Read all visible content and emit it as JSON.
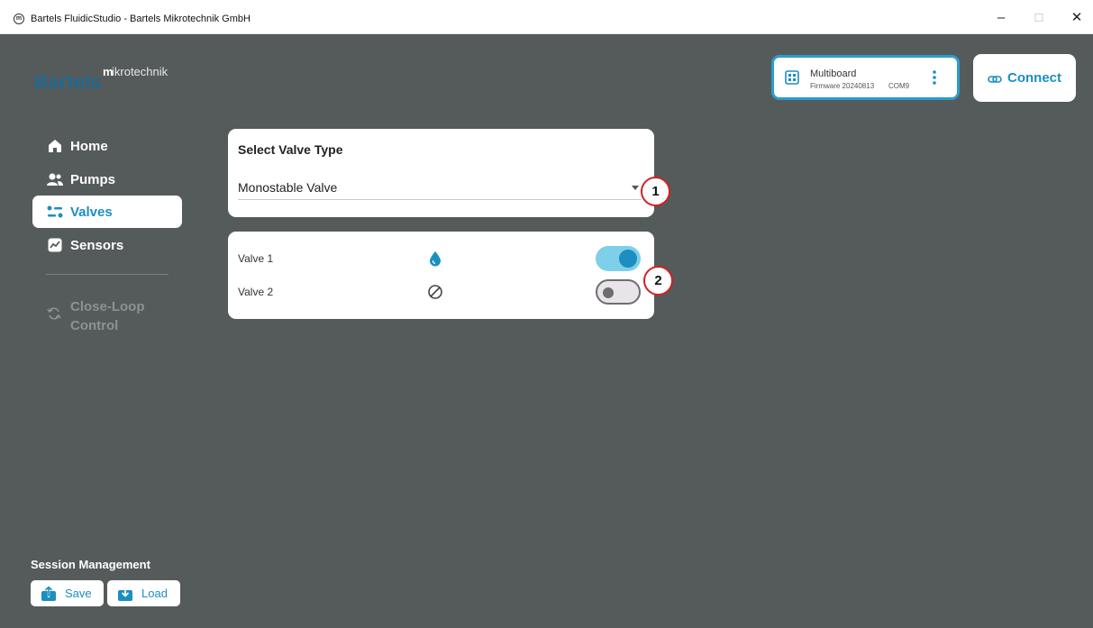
{
  "window": {
    "title": "Bartels FluidicStudio - Bartels Mikrotechnik GmbH",
    "app_icon": "m",
    "minimize_glyph": "–",
    "maximize_glyph": "☐",
    "close_glyph": "✕"
  },
  "logo": {
    "brand": "Bartels",
    "m": "m",
    "sub": "ikrotechnik"
  },
  "sidebar": {
    "items": [
      {
        "label": "Home",
        "icon": "home-icon",
        "active": false
      },
      {
        "label": "Pumps",
        "icon": "pumps-icon",
        "active": false
      },
      {
        "label": "Valves",
        "icon": "valves-icon",
        "active": true
      },
      {
        "label": "Sensors",
        "icon": "sensors-icon",
        "active": false
      }
    ],
    "close_loop": {
      "label": "Close-Loop Control",
      "icon": "refresh-icon",
      "disabled": true
    }
  },
  "session": {
    "title": "Session Management",
    "save_label": "Save",
    "load_label": "Load"
  },
  "device": {
    "name": "Multiboard",
    "firmware": "Firmware 20240813",
    "port": "COM9"
  },
  "connect": {
    "label": "Connect"
  },
  "valve_type": {
    "heading": "Select Valve Type",
    "selected": "Monostable Valve"
  },
  "valves": [
    {
      "label": "Valve 1",
      "state_icon": "water-drop-icon",
      "on": true
    },
    {
      "label": "Valve 2",
      "state_icon": "blocked-icon",
      "on": false
    }
  ],
  "callouts": [
    "1",
    "2"
  ],
  "colors": {
    "accent": "#1c8ec0",
    "background": "#555b5b",
    "callout_border": "#d32020",
    "toggle_on_track": "#7ecfe8"
  }
}
